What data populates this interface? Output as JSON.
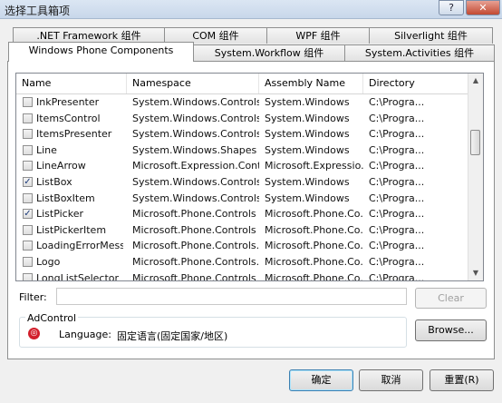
{
  "window": {
    "title": "选择工具箱项",
    "help_glyph": "?",
    "close_glyph": "✕"
  },
  "tabs_row1": [
    ".NET Framework 组件",
    "COM 组件",
    "WPF 组件",
    "Silverlight 组件"
  ],
  "tabs_row2": [
    "Windows Phone Components",
    "System.Workflow 组件",
    "System.Activities 组件"
  ],
  "active_tab": "Windows Phone Components",
  "list": {
    "columns": [
      "Name",
      "Namespace",
      "Assembly Name",
      "Directory"
    ],
    "rows": [
      {
        "checked": false,
        "name": "InkPresenter",
        "namespace": "System.Windows.Controls",
        "assembly": "System.Windows",
        "dir": "C:\\Progra..."
      },
      {
        "checked": false,
        "name": "ItemsControl",
        "namespace": "System.Windows.Controls",
        "assembly": "System.Windows",
        "dir": "C:\\Progra..."
      },
      {
        "checked": false,
        "name": "ItemsPresenter",
        "namespace": "System.Windows.Controls",
        "assembly": "System.Windows",
        "dir": "C:\\Progra..."
      },
      {
        "checked": false,
        "name": "Line",
        "namespace": "System.Windows.Shapes",
        "assembly": "System.Windows",
        "dir": "C:\\Progra..."
      },
      {
        "checked": false,
        "name": "LineArrow",
        "namespace": "Microsoft.Expression.Cont...",
        "assembly": "Microsoft.Expressio...",
        "dir": "C:\\Progra..."
      },
      {
        "checked": true,
        "name": "ListBox",
        "namespace": "System.Windows.Controls",
        "assembly": "System.Windows",
        "dir": "C:\\Progra..."
      },
      {
        "checked": false,
        "name": "ListBoxItem",
        "namespace": "System.Windows.Controls",
        "assembly": "System.Windows",
        "dir": "C:\\Progra..."
      },
      {
        "checked": true,
        "name": "ListPicker",
        "namespace": "Microsoft.Phone.Controls",
        "assembly": "Microsoft.Phone.Co...",
        "dir": "C:\\Progra..."
      },
      {
        "checked": false,
        "name": "ListPickerItem",
        "namespace": "Microsoft.Phone.Controls",
        "assembly": "Microsoft.Phone.Co...",
        "dir": "C:\\Progra..."
      },
      {
        "checked": false,
        "name": "LoadingErrorMess...",
        "namespace": "Microsoft.Phone.Controls...",
        "assembly": "Microsoft.Phone.Co...",
        "dir": "C:\\Progra..."
      },
      {
        "checked": false,
        "name": "Logo",
        "namespace": "Microsoft.Phone.Controls...",
        "assembly": "Microsoft.Phone.Co...",
        "dir": "C:\\Progra..."
      },
      {
        "checked": false,
        "name": "LongListSelector",
        "namespace": "Microsoft.Phone.Controls",
        "assembly": "Microsoft.Phone.Co...",
        "dir": "C:\\Progra..."
      }
    ]
  },
  "filter": {
    "label": "Filter:",
    "value": ""
  },
  "buttons": {
    "clear": "Clear",
    "browse": "Browse...",
    "ok": "确定",
    "cancel": "取消",
    "reset": "重置(R)"
  },
  "details": {
    "title": "AdControl",
    "language_label": "Language:",
    "language_value": "固定语言(固定国家/地区)"
  }
}
